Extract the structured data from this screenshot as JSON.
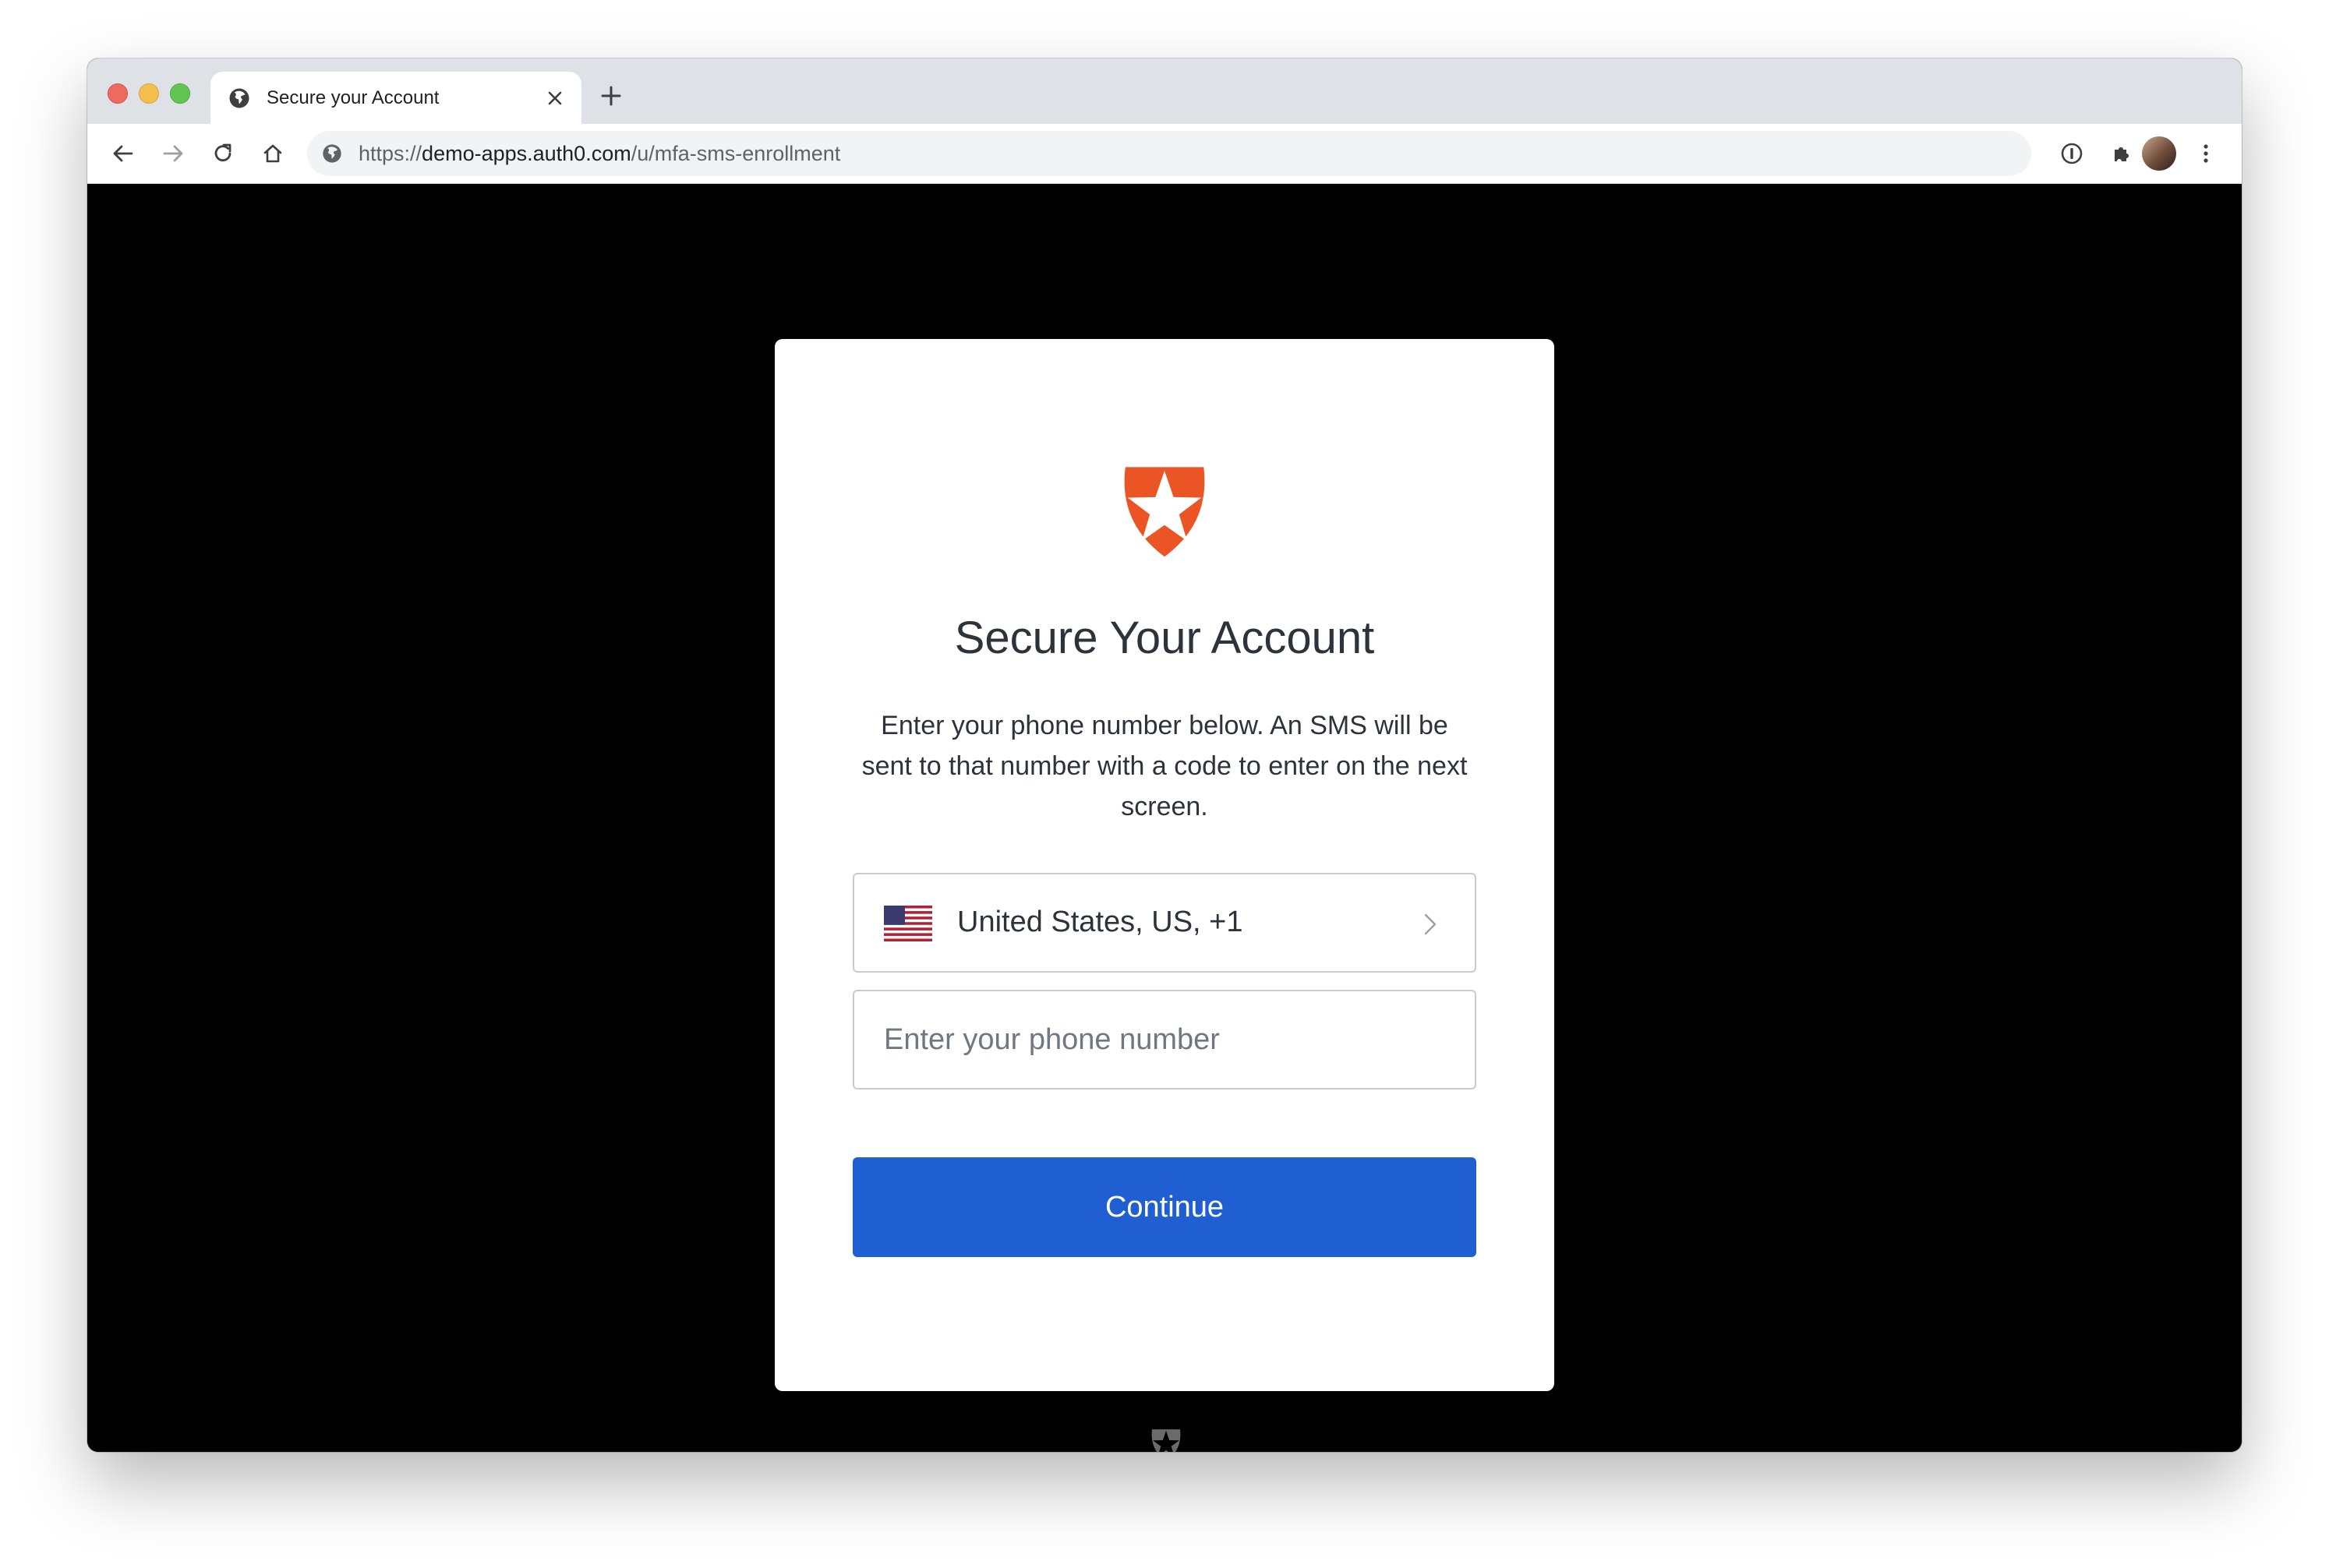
{
  "browser": {
    "tab_title": "Secure your Account",
    "tab_favicon": "globe-icon",
    "url_scheme": "https://",
    "url_host": "demo-apps.auth0.com",
    "url_path": "/u/mfa-sms-enrollment",
    "toolbar_icons": [
      "back-icon",
      "forward-icon",
      "reload-icon",
      "home-icon",
      "info-icon",
      "extensions-icon",
      "profile-avatar",
      "menu-icon"
    ]
  },
  "colors": {
    "brand": "#eb5424",
    "primary_button": "#1f5fd1",
    "text": "#2d333a",
    "page_background": "#000000"
  },
  "card": {
    "logo": "auth0-shield-star-logo",
    "title": "Secure Your Account",
    "description": "Enter your phone number below. An SMS will be sent to that number with a code to enter on the next screen.",
    "country": {
      "flag": "us-flag-icon",
      "label": "United States, US, +1"
    },
    "phone": {
      "value": "",
      "placeholder": "Enter your phone number"
    },
    "continue_label": "Continue"
  },
  "footer": {
    "logo": "auth0-footer-logo"
  }
}
